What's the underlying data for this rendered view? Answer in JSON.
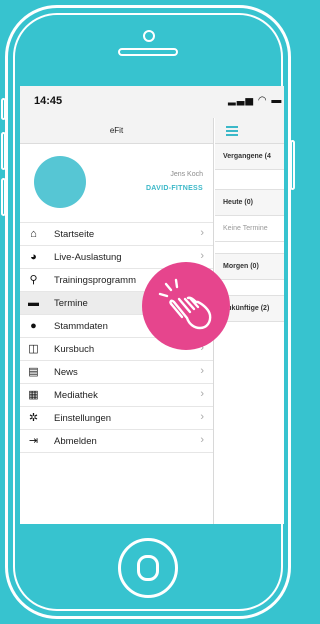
{
  "status": {
    "time": "14:45",
    "icons": "▂▃▅ ◠ ▬"
  },
  "app": {
    "title": "eFit"
  },
  "profile": {
    "name": "Jens Koch",
    "studio": "DAVID-FITNESS"
  },
  "menu": {
    "items": [
      {
        "label": "Startseite",
        "icon": "home-icon",
        "glyph": "⌂"
      },
      {
        "label": "Live-Auslastung",
        "icon": "pie-chart-icon",
        "glyph": "◕"
      },
      {
        "label": "Trainingsprogramm",
        "icon": "bicycle-icon",
        "glyph": "⚲"
      },
      {
        "label": "Termine",
        "icon": "calendar-icon",
        "glyph": "▬"
      },
      {
        "label": "Stammdaten",
        "icon": "person-icon",
        "glyph": "●"
      },
      {
        "label": "Kursbuch",
        "icon": "book-icon",
        "glyph": "◫"
      },
      {
        "label": "News",
        "icon": "news-icon",
        "glyph": "▤"
      },
      {
        "label": "Mediathek",
        "icon": "film-icon",
        "glyph": "▦"
      },
      {
        "label": "Einstellungen",
        "icon": "gear-icon",
        "glyph": "✲"
      },
      {
        "label": "Abmelden",
        "icon": "logout-icon",
        "glyph": "⇥"
      }
    ],
    "chevron": "›"
  },
  "schedule": {
    "vergangene": "Vergangene (4",
    "heute": "Heute (0)",
    "keine": "Keine Termine",
    "morgen": "Morgen (0)",
    "zukuenftige": "Zukünftige (2)"
  },
  "colors": {
    "background": "#37c3cf",
    "accent": "#3bb8c8",
    "touch": "#e6458d"
  }
}
